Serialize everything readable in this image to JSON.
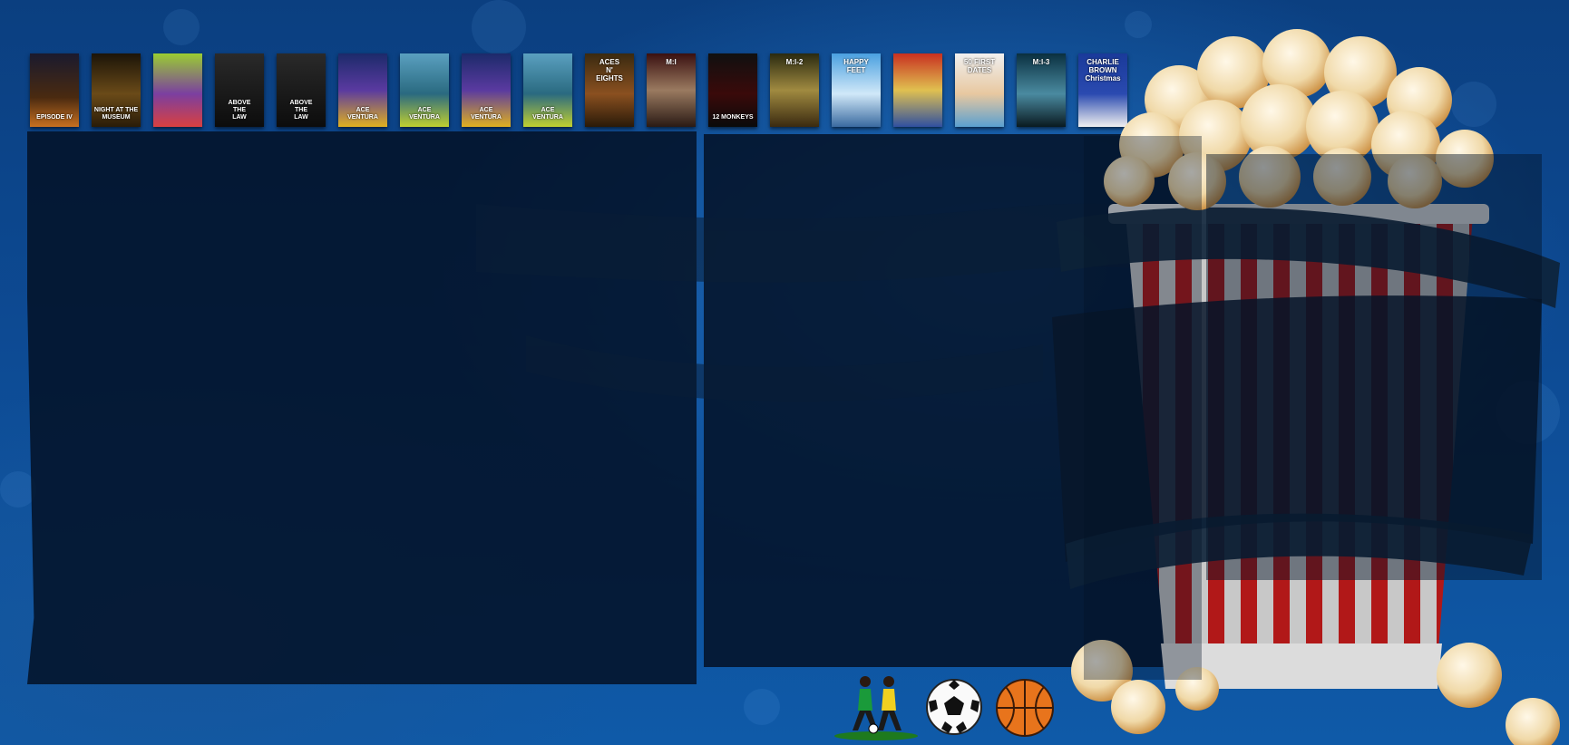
{
  "posters": [
    {
      "name": "star-wars-poster",
      "top": "",
      "bottom": "EPISODE IV",
      "bg": "linear-gradient(180deg,#1a1a2e 0%,#4a2a10 60%,#c87020 100%)"
    },
    {
      "name": "night-at-the-museum-poster",
      "top": "",
      "bottom": "NIGHT AT THE MUSEUM",
      "bg": "linear-gradient(180deg,#1b1408 0%,#6a4a18 55%,#2a1c08 100%)"
    },
    {
      "name": "veggietales-poster",
      "top": "",
      "bottom": "",
      "bg": "linear-gradient(180deg,#9acd32 0%,#7b3fa0 55%,#d94040 100%)"
    },
    {
      "name": "above-the-law-poster-1",
      "top": "",
      "bottom": "ABOVE\nTHE\nLAW",
      "bg": "linear-gradient(180deg,#2a2a2a 0%,#0c0c0c 100%)"
    },
    {
      "name": "above-the-law-poster-2",
      "top": "",
      "bottom": "ABOVE\nTHE\nLAW",
      "bg": "linear-gradient(180deg,#2a2a2a 0%,#0c0c0c 100%)"
    },
    {
      "name": "ace-ventura-poster-1",
      "top": "",
      "bottom": "ACE VENTURA",
      "bg": "linear-gradient(180deg,#1c2a6a 0%,#5a3aa0 50%,#e0b020 100%)"
    },
    {
      "name": "ace-ventura-poster-2",
      "top": "",
      "bottom": "ACE VENTURA",
      "bg": "linear-gradient(180deg,#5aa0c0 0%,#2a6a80 55%,#c0d030 100%)"
    },
    {
      "name": "ace-ventura-poster-3",
      "top": "",
      "bottom": "ACE VENTURA",
      "bg": "linear-gradient(180deg,#1c2a6a 0%,#5a3aa0 50%,#e0b020 100%)"
    },
    {
      "name": "ace-ventura-poster-4",
      "top": "",
      "bottom": "ACE VENTURA",
      "bg": "linear-gradient(180deg,#5aa0c0 0%,#2a6a80 55%,#c0d030 100%)"
    },
    {
      "name": "aces-n-eights-poster",
      "top": "ACES\nN'\nEIGHTS",
      "bottom": "",
      "bg": "linear-gradient(180deg,#3a2a10 0%,#8a5020 55%,#2a1a08 100%)"
    },
    {
      "name": "mission-impossible-poster",
      "top": "M:I",
      "bottom": "",
      "bg": "linear-gradient(180deg,#3a1010 0%,#9a7a60 50%,#2a1a14 100%)"
    },
    {
      "name": "12-monkeys-poster",
      "top": "",
      "bottom": "12 MONKEYS",
      "bg": "linear-gradient(180deg,#101010 0%,#3a0a0a 55%,#0a0a0a 100%)"
    },
    {
      "name": "mission-impossible-2-poster",
      "top": "M:I-2",
      "bottom": "",
      "bg": "linear-gradient(180deg,#2a2a10 0%,#a08a40 50%,#3a2a10 100%)"
    },
    {
      "name": "happy-feet-poster",
      "top": "HAPPY\nFEET",
      "bottom": "",
      "bg": "linear-gradient(180deg,#4aa0e0 0%,#d0e8f8 55%,#3a6aa0 100%)"
    },
    {
      "name": "comedy-collection-poster",
      "top": "",
      "bottom": "",
      "bg": "linear-gradient(180deg,#c83020 0%,#e0c050 50%,#3050a0 100%)"
    },
    {
      "name": "50-first-dates-poster",
      "top": "50 FIRST DATES",
      "bottom": "",
      "bg": "linear-gradient(180deg,#f0f0f0 0%,#e8c8a0 55%,#5aa0d0 100%)"
    },
    {
      "name": "mission-impossible-3-poster",
      "top": "M:I-3",
      "bottom": "",
      "bg": "linear-gradient(180deg,#0a3040 0%,#4a8aa0 55%,#0a1a20 100%)"
    },
    {
      "name": "charlie-brown-christmas-poster",
      "top": "CHARLIE\nBROWN\nChristmas",
      "bottom": "",
      "bg": "linear-gradient(180deg,#1a3a9a 0%,#2a4ab0 55%,#f0f0f0 100%)"
    }
  ],
  "sports": [
    {
      "name": "soccer-players-icon"
    },
    {
      "name": "soccer-ball-icon"
    },
    {
      "name": "basketball-icon"
    }
  ]
}
